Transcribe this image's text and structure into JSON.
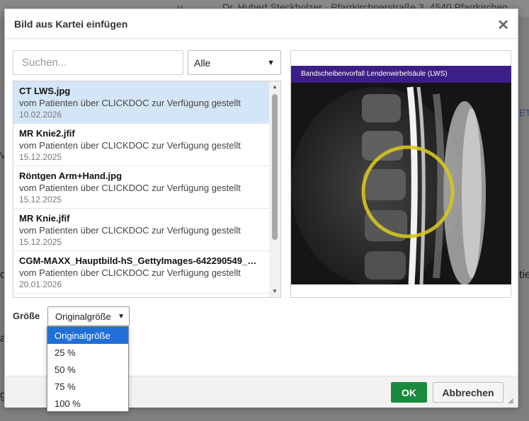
{
  "background": {
    "patient_text": "Dr. Hubert Steckholzer · Pfarrkirchnerstraße 3, 4540 Pfarrkirchen",
    "chevron_glyph": "∨",
    "fragments": [
      "c",
      "ar",
      "g",
      "tie",
      "V"
    ],
    "link_text": "ET"
  },
  "dialog": {
    "title": "Bild aus Kartei einfügen",
    "close_glyph": "✕"
  },
  "search": {
    "placeholder": "Suchen...",
    "value": ""
  },
  "filter": {
    "selected": "Alle",
    "chevron": "⌄"
  },
  "files": [
    {
      "name": "CT LWS.jpg",
      "description": "vom Patienten über CLICKDOC zur Verfügung gestellt",
      "date": "10.02.2026",
      "selected": true
    },
    {
      "name": "MR Knie2.jfif",
      "description": "vom Patienten über CLICKDOC zur Verfügung gestellt",
      "date": "15.12.2025",
      "selected": false
    },
    {
      "name": "Röntgen Arm+Hand.jpg",
      "description": "vom Patienten über CLICKDOC zur Verfügung gestellt",
      "date": "15.12.2025",
      "selected": false
    },
    {
      "name": "MR Knie.jfif",
      "description": "vom Patienten über CLICKDOC zur Verfügung gestellt",
      "date": "15.12.2025",
      "selected": false
    },
    {
      "name": "CGM-MAXX_Hauptbild-hS_GettyImages-642290549_…",
      "description": "vom Patienten über CLICKDOC zur Verfügung gestellt",
      "date": "20.01.2026",
      "selected": false
    }
  ],
  "scrollbar": {
    "up": "▲",
    "down": "▼"
  },
  "preview": {
    "banner": "Bandscheibenvorfall Lendenwirbelsäule (LWS)"
  },
  "size": {
    "label": "Größe",
    "selected": "Originalgröße",
    "chevron": "⌄",
    "options": [
      "Originalgröße",
      "25 %",
      "50 %",
      "75 %",
      "100 %"
    ]
  },
  "footer": {
    "ok_label": "OK",
    "cancel_label": "Abbrechen",
    "grip": "◢"
  },
  "colors": {
    "ok_button": "#1a8b3c",
    "selected_row": "#d4e5f7",
    "active_option": "#1f6fd6",
    "banner": "#3b1f86",
    "highlight_ring": "#d6c51c"
  }
}
